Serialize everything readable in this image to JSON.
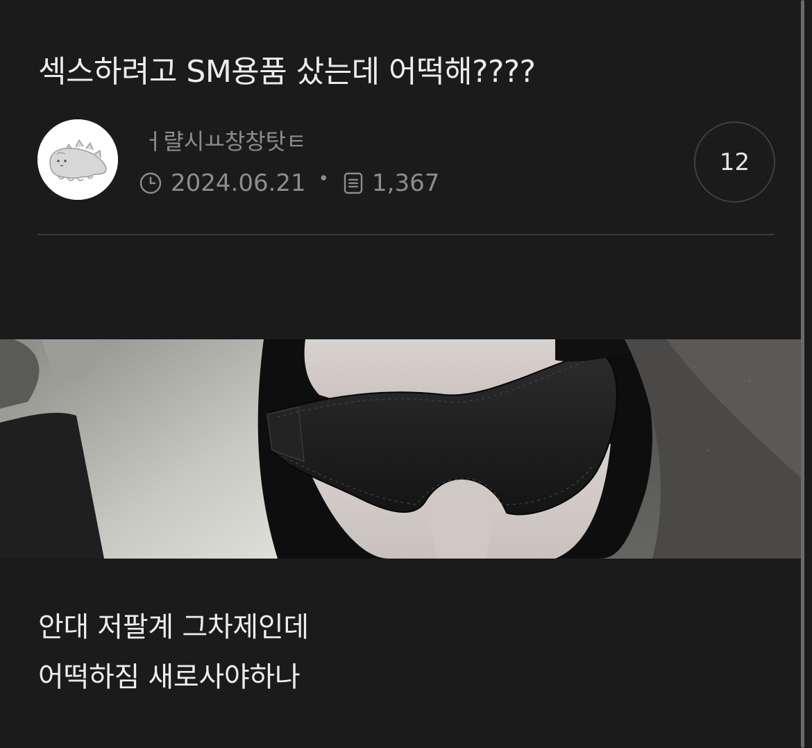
{
  "post": {
    "title": "섹스하려고 SM용품 샀는데 어떡해????",
    "author": "ㅓ랼시ㅛ창창탓ㅌ",
    "date": "2024.06.21",
    "views": "1,367",
    "comment_count": "12",
    "body_lines": [
      "안대 저팔계 그차제인데",
      "어떡하짐 새로사야하나"
    ]
  },
  "icons": {
    "avatar": "dinosaur-avatar-icon",
    "date": "clock-icon",
    "views": "document-icon"
  },
  "colors": {
    "background": "#1b1b1c",
    "text": "#ededed",
    "muted": "#8d8d8d",
    "divider": "#3a3a3c"
  }
}
